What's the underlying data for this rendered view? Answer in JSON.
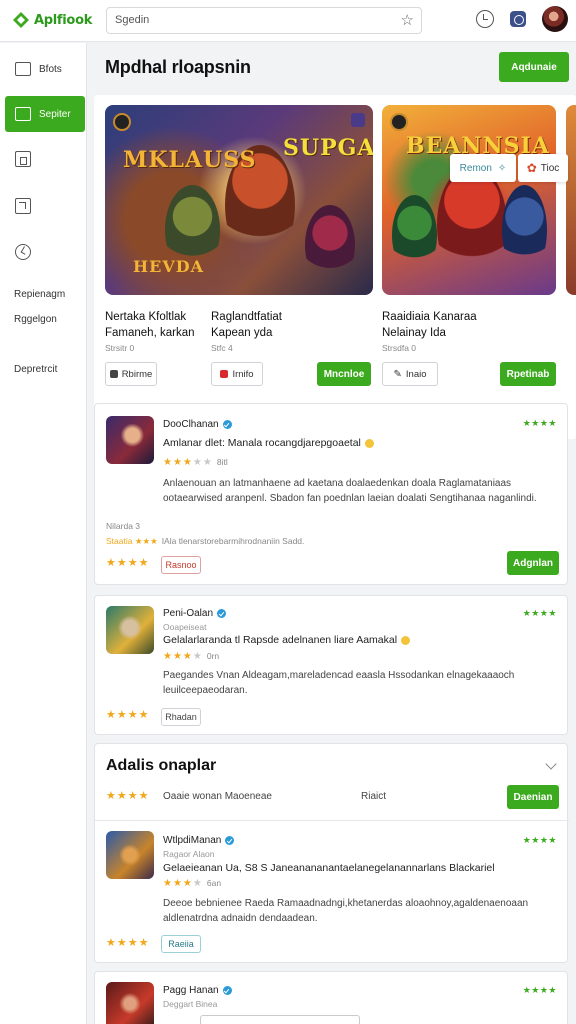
{
  "app": {
    "logo_text": "Aplfiook",
    "accent": "#3caa1e"
  },
  "header": {
    "search_placeholder": "Sgedin",
    "icons": [
      "star-icon",
      "history-icon",
      "language-icon",
      "avatar"
    ]
  },
  "sidebar": {
    "items": [
      {
        "label": "Bfots",
        "icon": "grid-icon",
        "active": false
      },
      {
        "label": "Sepiter",
        "icon": "square-icon",
        "active": true
      }
    ],
    "icon_items": [
      "store-icon",
      "update-icon",
      "clock-icon"
    ],
    "text_items": [
      "Repienagm",
      "Rggelgon",
      "Depretrcit"
    ]
  },
  "main": {
    "title": "Mpdhal rloapsnin",
    "top_action": "Aqdunaie",
    "tab_pill_1": "Remon",
    "tab_pill_2": "Tioc",
    "featured": [
      {
        "logo_a": "MKLAUSS",
        "logo_b": "SUPGA",
        "logo_c": "HEVDA",
        "title_line1": "Nertaka Kfoltlak",
        "title_line2": "Famaneh, karkan",
        "rating": "Strsitr 0",
        "button": "Rbirme",
        "get": ""
      },
      {
        "title_line1": "Raglandtfatiat",
        "title_line2": "Kapean yda",
        "rating": "Stfc 4",
        "button": "Irnifo",
        "get": "Mncnloe"
      },
      {
        "logo_a": "BEANNSIA",
        "title_line1": "Raaidiaia Kanaraa",
        "title_line2": "Nelainay Ida",
        "rating": "Strsdfa 0",
        "button": "Inaio",
        "get": "Rpetinab"
      }
    ],
    "reviews": [
      {
        "name": "DooClhanan",
        "headline": "Amlanar dlet: Manala rocangdjarepgoaetal",
        "stars_on": 3,
        "stars_off": 2,
        "count": "8itl",
        "badge": "★★★★",
        "body": "Anlaenouan an latmanhaene ad kaetana doalaedenkan doala Raglamataniaas ootaearwised aranpenl. Sbadon fan poednlan laeian doalati Sengtihanaa naganlindi.",
        "meta1": "Nilarda 3",
        "meta2_stars": "Staatia ★★★",
        "meta2_text": "IAla tlenarstorebarmihrodnaniin Sadd.",
        "foot_btn": "Rasnoo",
        "action": "Adgnlan"
      },
      {
        "name": "Peni-Oalan",
        "sub": "Ooapeiseat",
        "headline": "Gelalarlaranda tl Rapsde adelnanen liare Aamakal",
        "stars_on": 3,
        "stars_off": 2,
        "count": "0rn",
        "badge": "★★★★",
        "body": "Paegandes Vnan Aldeagam,mareladencad eaasla Hssodankan elnagekaaaoch leuilceepaeodaran.",
        "foot_btn": "Rhadan"
      }
    ],
    "section2": {
      "title": "Adalis onaplar",
      "stars": "★★★★",
      "label": "Oaaie wonan Maoeneae",
      "count": "Riaict",
      "action": "Daenian"
    },
    "reviews2": [
      {
        "name": "WtlpdiManan",
        "sub": "Ragaor Alaon",
        "headline": "Gelaeieanan Ua, S8 S Janeanananantaelanegelanannarlans Blackariel",
        "stars_on": 3,
        "stars_off": 1,
        "count": "6an",
        "badge": "★★★★",
        "body": "Deeoe bebnienee Raeda Ramaadnadngi,khetanerdas aloaohnoy,agaldenaenoaan aldlenatrdna adnaidn dendaadean.",
        "foot_btn": "Raeiia"
      },
      {
        "name": "Pagg Hanan",
        "sub": "Deggart Binea",
        "badge": "★★★★"
      }
    ]
  }
}
